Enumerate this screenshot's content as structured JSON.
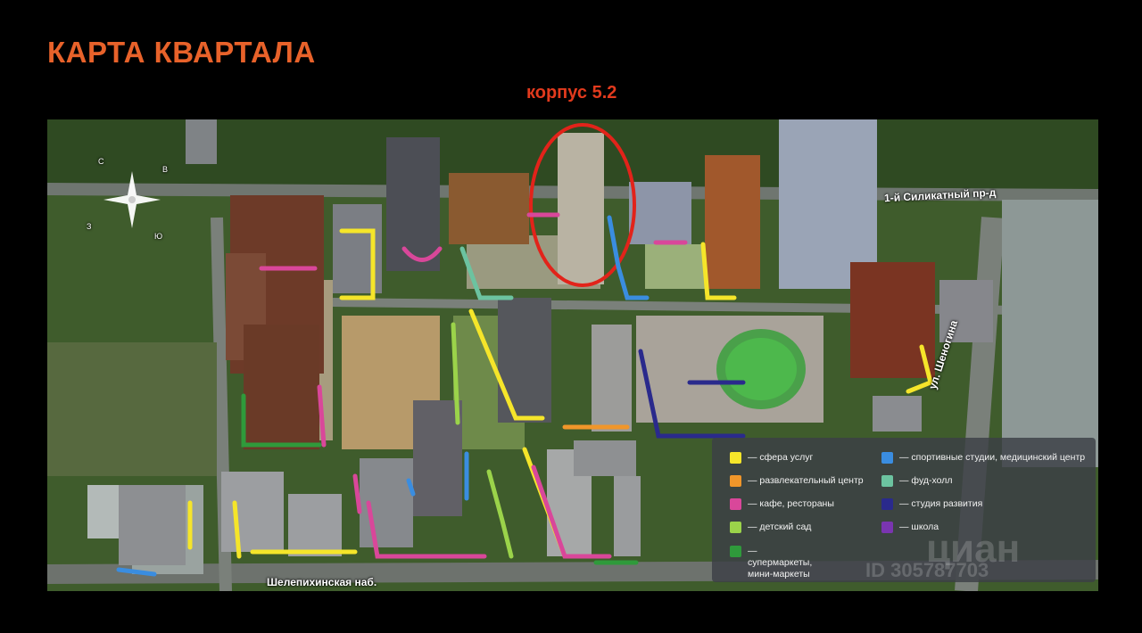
{
  "title": "КАРТА КВАРТАЛА",
  "highlight_label": "корпус 5.2",
  "streets": {
    "silikatny": "1-й Силикатный пр-д",
    "shenogina": "ул. Шеногина",
    "shelepikhinskaya": "Шелепихинская наб."
  },
  "compass": {
    "n": "С",
    "e": "В",
    "s": "Ю",
    "w": "З"
  },
  "legend": {
    "items": [
      {
        "label": "— сфера услуг",
        "color": "#f5e52a"
      },
      {
        "label": "— развлекательный центр",
        "color": "#f0962a"
      },
      {
        "label": "— кафе, рестораны",
        "color": "#d9479a"
      },
      {
        "label": "— детский сад",
        "color": "#9bd34a"
      },
      {
        "label": "— супермаркеты, мини-маркеты",
        "color": "#2f9a3b"
      },
      {
        "label": "— спортивные студии, медицинский центр",
        "color": "#3a8de0"
      },
      {
        "label": "— фуд-холл",
        "color": "#6cc3a0"
      },
      {
        "label": "— студия развития",
        "color": "#2a2a8c"
      },
      {
        "label": "— школа",
        "color": "#7a35b0"
      }
    ]
  },
  "watermark": {
    "brand": "циан",
    "id": "ID 305787703"
  },
  "colors": {
    "title": "#e8622a",
    "highlight": "#e23a1d"
  }
}
